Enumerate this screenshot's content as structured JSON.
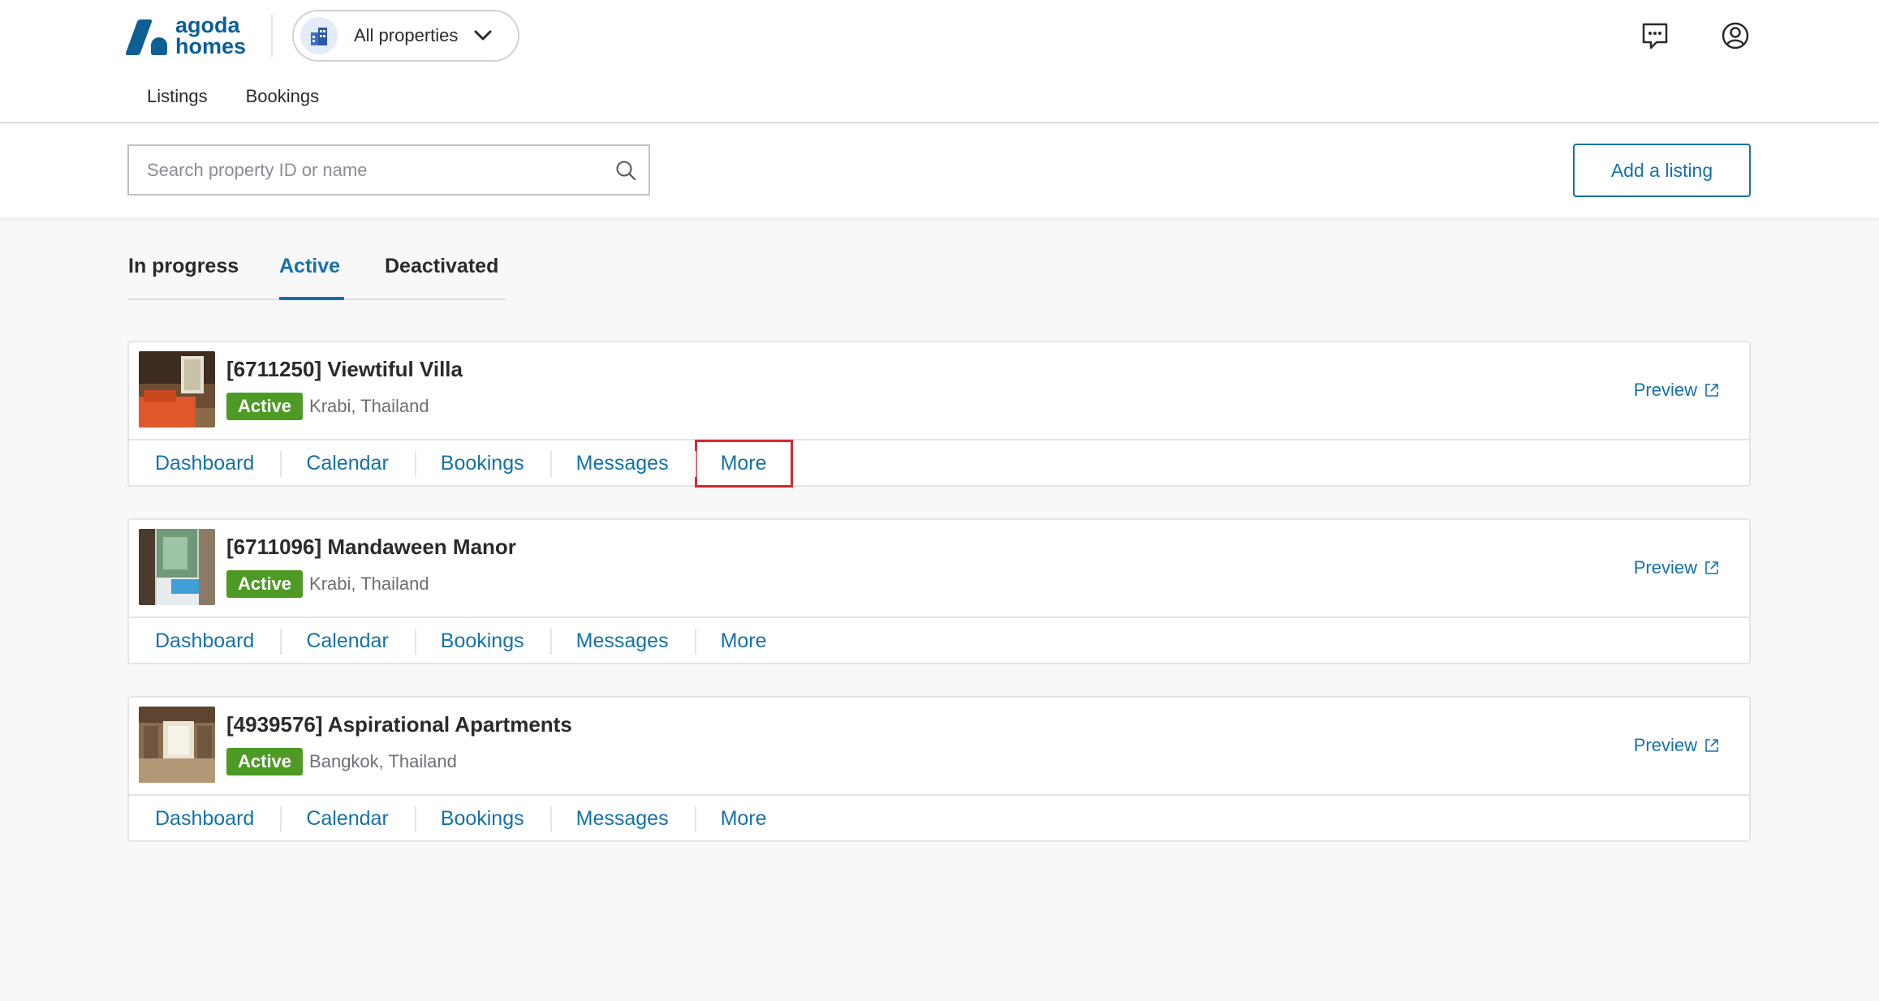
{
  "header": {
    "logo_line1": "agoda",
    "logo_line2": "homes",
    "property_selector": "All properties",
    "nav": [
      "Listings",
      "Bookings"
    ]
  },
  "toolbar": {
    "search_placeholder": "Search property ID or name",
    "add_listing_label": "Add a listing"
  },
  "tabs": [
    {
      "label": "In progress",
      "active": false
    },
    {
      "label": "Active",
      "active": true
    },
    {
      "label": "Deactivated",
      "active": false
    }
  ],
  "listings": [
    {
      "title": "[6711250] Viewtiful Villa",
      "status": "Active",
      "location": "Krabi, Thailand",
      "preview": "Preview"
    },
    {
      "title": "[6711096] Mandaween Manor",
      "status": "Active",
      "location": "Krabi, Thailand",
      "preview": "Preview"
    },
    {
      "title": "[4939576] Aspirational Apartments",
      "status": "Active",
      "location": "Bangkok, Thailand",
      "preview": "Preview"
    }
  ],
  "card_actions": [
    "Dashboard",
    "Calendar",
    "Bookings",
    "Messages",
    "More"
  ],
  "colors": {
    "brand": "#0d5f94",
    "link": "#1571a8",
    "active_badge": "#4d9a24",
    "highlight": "#e0242c"
  }
}
